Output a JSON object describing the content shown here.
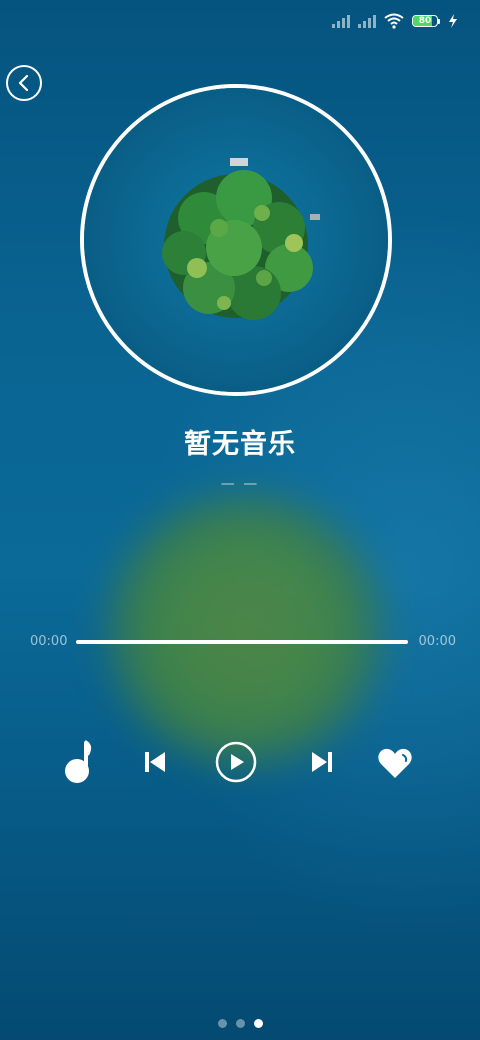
{
  "status_bar": {
    "battery_level": "80",
    "battery_fraction": 0.8,
    "charging": true,
    "icons": [
      "signal-icon-1",
      "signal-icon-2",
      "wifi-icon",
      "battery-icon",
      "charging-bolt-icon"
    ]
  },
  "header": {
    "back_icon": "chevron-left-icon"
  },
  "now_playing": {
    "title": "暂无音乐",
    "artist": "— —",
    "album_art": "island-in-lake"
  },
  "progress": {
    "current_time": "00:00",
    "total_time": "00:00",
    "position_fraction": 0
  },
  "controls": {
    "icons": [
      "music-note-icon",
      "previous-track-icon",
      "play-icon",
      "next-track-icon",
      "heart-icon"
    ]
  },
  "pager": {
    "count": 3,
    "active_index": 2
  },
  "colors": {
    "background": "#0a6593",
    "accent": "#ffffff",
    "battery_fill": "#4cd964"
  }
}
